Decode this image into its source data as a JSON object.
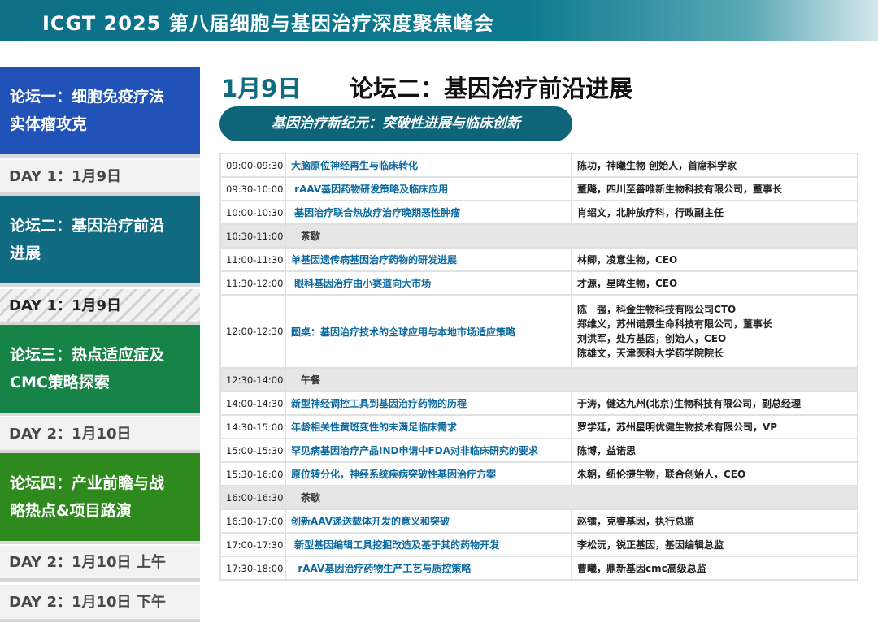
{
  "header": {
    "title": "ICGT 2025 第八届细胞与基因治疗深度聚焦峰会"
  },
  "sidebar": {
    "forum1": {
      "line1": "论坛一：细胞免疫疗法",
      "line2": "实体瘤攻克"
    },
    "day1": "DAY 1：1月9日",
    "forum2": {
      "line1": "论坛二：基因治疗前沿",
      "line2": "进展"
    },
    "day1_active": "DAY 1：1月9日",
    "forum3": {
      "line1": "论坛三：热点适应症及",
      "line2": "CMC策略探索"
    },
    "day2": "DAY 2：1月10日",
    "forum4": {
      "line1": "论坛四：产业前瞻与战",
      "line2": "略热点&项目路演"
    },
    "day2_am": "DAY 2：1月10日 上午",
    "day2_pm": "DAY 2：1月10日 下午"
  },
  "main": {
    "date": "1月9日",
    "title": "论坛二：基因治疗前沿进展",
    "subtitle": "基因治疗新纪元：突破性进展与临床创新"
  },
  "schedule": [
    {
      "time": "09:00-09:30",
      "topic": "大脑原位神经再生与临床转化",
      "speakers": [
        "陈功，神曦生物  创始人，首席科学家"
      ]
    },
    {
      "time": "09:30-10:00",
      "topic": " rAAV基因药物研发策略及临床应用",
      "speakers": [
        "董飚，四川至善唯新生物科技有限公司，董事长"
      ]
    },
    {
      "time": "10:00-10:30",
      "topic": " 基因治疗联合热放疗治疗晚期恶性肿瘤",
      "speakers": [
        "肖绍文，北肿放疗科，行政副主任"
      ]
    },
    {
      "time": "10:30-11:00",
      "break": "茶歇"
    },
    {
      "time": "11:00-11:30",
      "topic": "单基因遗传病基因治疗药物的研发进展",
      "speakers": [
        "林卿，凌意生物，CEO"
      ]
    },
    {
      "time": "11:30-12:00",
      "topic": " 眼科基因治疗由小赛道向大市场",
      "speakers": [
        "才源，星眸生物，CEO"
      ]
    },
    {
      "time": "12:00-12:30",
      "topic": "圆桌：基因治疗技术的全球应用与本地市场适应策略",
      "speakers": [
        "陈　强，科金生物科技有限公司CTO",
        "郑维义，苏州诺景生命科技有限公司，董事长",
        "刘洪军，处方基因，创始人，CEO",
        "陈雄文，天津医科大学药学院院长"
      ]
    },
    {
      "time": "12:30-14:00",
      "break": "午餐"
    },
    {
      "time": "14:00-14:30",
      "topic": "新型神经调控工具到基因治疗药物的历程",
      "speakers": [
        "于涛，健达九州(北京)生物科技有限公司，副总经理"
      ]
    },
    {
      "time": "14:30-15:00",
      "topic": "年龄相关性黄斑变性的未满足临床需求",
      "speakers": [
        "罗学廷，苏州星明优健生物技术有限公司，VP"
      ]
    },
    {
      "time": "15:00-15:30",
      "topic": "罕见病基因治疗产品IND申请中FDA对非临床研究的要求",
      "speakers": [
        "陈博，益诺思"
      ]
    },
    {
      "time": "15:30-16:00",
      "topic": "原位转分化，神经系统疾病突破性基因治疗方案",
      "speakers": [
        "朱朝，纽伦捷生物，联合创始人，CEO"
      ]
    },
    {
      "time": "16:00-16:30",
      "break": "茶歇"
    },
    {
      "time": "16:30-17:00",
      "topic": "创新AAV递送载体开发的意义和突破",
      "speakers": [
        "赵镭，克睿基因，执行总监"
      ]
    },
    {
      "time": "17:00-17:30",
      "topic": " 新型基因编辑工具挖掘改造及基于其的药物开发",
      "speakers": [
        "李松沅，锐正基因，基因编辑总监"
      ]
    },
    {
      "time": "17:30-18:00",
      "topic": "  rAAV基因治疗药物生产工艺与质控策略",
      "speakers": [
        "曹曦，鼎新基因cmc高级总监"
      ]
    }
  ]
}
